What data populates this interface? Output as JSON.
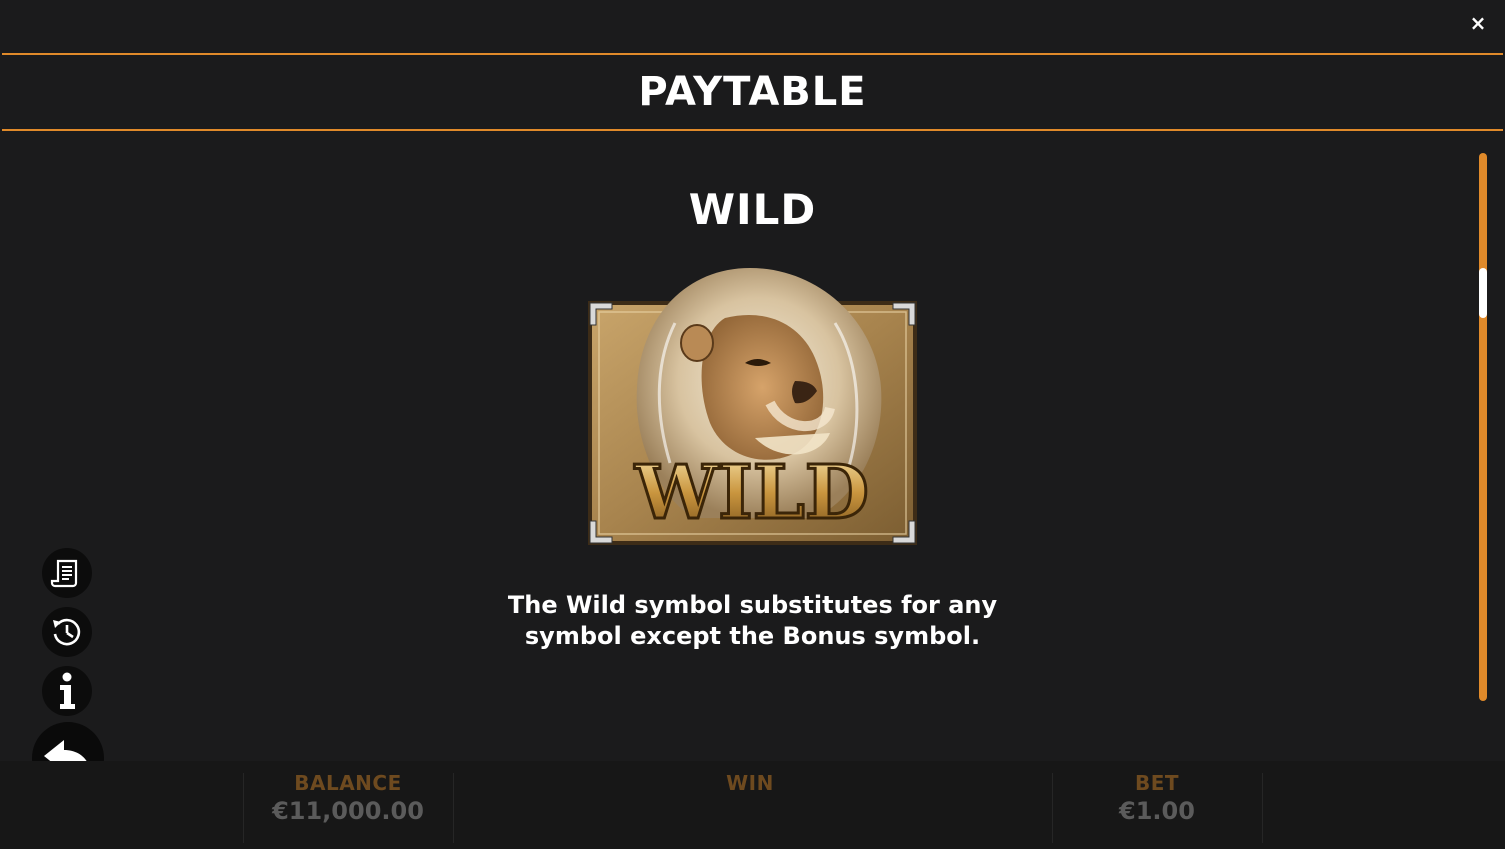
{
  "header": {
    "title": "PAYTABLE",
    "close_label": "×"
  },
  "symbol": {
    "name": "WILD",
    "image_label": "WILD",
    "description_line1": "The Wild symbol substitutes for any",
    "description_line2": "symbol except the Bonus symbol."
  },
  "sidebar": {
    "items": [
      {
        "icon": "paytable-scroll-icon"
      },
      {
        "icon": "history-icon"
      },
      {
        "icon": "info-icon"
      },
      {
        "icon": "back-arrow-icon"
      }
    ]
  },
  "bottom_bar": {
    "balance_label": "BALANCE",
    "balance_value": "€11,000.00",
    "win_label": "WIN",
    "win_value": "",
    "bet_label": "BET",
    "bet_value": "€1.00"
  },
  "scrollbar": {
    "position_fraction": 0.23
  },
  "colors": {
    "accent": "#e08a2a",
    "background": "#1b1b1c",
    "label_muted": "#6e4a1f",
    "value_muted": "#5b5b5b"
  }
}
